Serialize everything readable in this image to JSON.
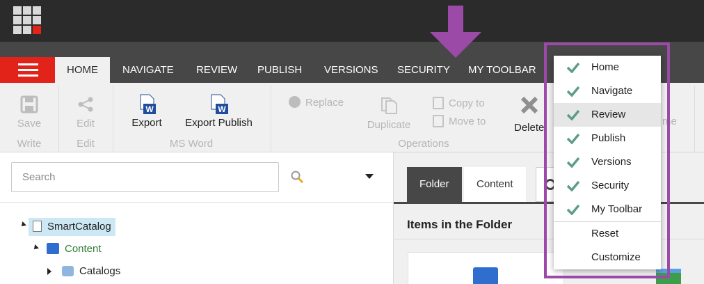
{
  "tabs": {
    "home": "HOME",
    "navigate": "NAVIGATE",
    "review": "REVIEW",
    "publish": "PUBLISH",
    "versions": "VERSIONS",
    "security": "SECURITY",
    "my_toolbar": "MY TOOLBAR"
  },
  "ribbon": {
    "save": "Save",
    "write_group": "Write",
    "edit": "Edit",
    "edit_group": "Edit",
    "export": "Export",
    "export_publish": "Export Publish",
    "msword_group": "MS Word",
    "replace": "Replace",
    "duplicate": "Duplicate",
    "copy_to": "Copy to",
    "move_to": "Move to",
    "operations_group": "Operations",
    "delete": "Delete",
    "hidden_right": "me",
    "word_icon_letter": "W"
  },
  "left_pane": {
    "search_placeholder": "Search",
    "tree": [
      {
        "label": "SmartCatalog"
      },
      {
        "label": "Content"
      },
      {
        "label": "Catalogs"
      }
    ]
  },
  "right_pane": {
    "tab_folder": "Folder",
    "tab_content": "Content",
    "items_title": "Items in the Folder"
  },
  "menu": {
    "items": [
      {
        "label": "Home",
        "checked": true
      },
      {
        "label": "Navigate",
        "checked": true
      },
      {
        "label": "Review",
        "checked": true
      },
      {
        "label": "Publish",
        "checked": true
      },
      {
        "label": "Versions",
        "checked": true
      },
      {
        "label": "Security",
        "checked": true
      },
      {
        "label": "My Toolbar",
        "checked": true
      },
      {
        "label": "Reset",
        "checked": false
      },
      {
        "label": "Customize",
        "checked": false
      }
    ]
  },
  "colors": {
    "accent_red": "#e2231a",
    "annotation_purple": "#9b4aa8",
    "check_green": "#5a9e83",
    "tree_green": "#2e7d32"
  }
}
